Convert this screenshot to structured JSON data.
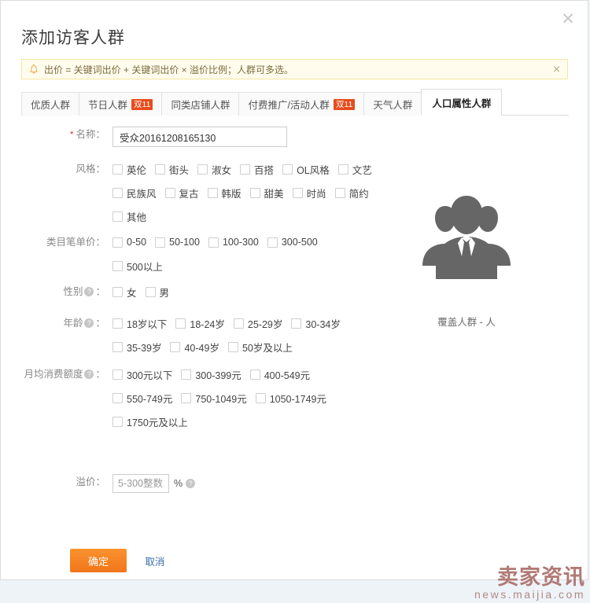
{
  "dialog": {
    "title": "添加访客人群",
    "close_icon": "close-icon"
  },
  "notice": {
    "icon": "bell-icon",
    "text": "出价 = 关键词出价 + 关键词出价 × 溢价比例；人群可多选。",
    "close_label": "×"
  },
  "tabs": [
    {
      "label": "优质人群",
      "badge": "",
      "active": false
    },
    {
      "label": "节日人群",
      "badge": "双11",
      "active": false
    },
    {
      "label": "同类店铺人群",
      "badge": "",
      "active": false
    },
    {
      "label": "付费推广/活动人群",
      "badge": "双11",
      "active": false
    },
    {
      "label": "天气人群",
      "badge": "",
      "active": false
    },
    {
      "label": "人口属性人群",
      "badge": "",
      "active": true
    }
  ],
  "form": {
    "name": {
      "label": "名称：",
      "required_mark": "*",
      "value": "受众20161208165130"
    },
    "style": {
      "label": "风格：",
      "options": [
        "英伦",
        "街头",
        "淑女",
        "百搭",
        "OL风格",
        "文艺",
        "民族风",
        "复古",
        "韩版",
        "甜美",
        "时尚",
        "简约",
        "其他"
      ]
    },
    "unit_price": {
      "label": "类目笔单价：",
      "options": [
        "0-50",
        "50-100",
        "100-300",
        "300-500",
        "500以上"
      ]
    },
    "gender": {
      "label": "性别",
      "help_icon": "question-icon",
      "colon": "：",
      "options": [
        "女",
        "男"
      ]
    },
    "age": {
      "label": "年龄",
      "help_icon": "question-icon",
      "colon": "：",
      "options": [
        "18岁以下",
        "18-24岁",
        "25-29岁",
        "30-34岁",
        "35-39岁",
        "40-49岁",
        "50岁及以上"
      ]
    },
    "spend": {
      "label": "月均消费额度",
      "help_icon": "question-icon",
      "colon": "：",
      "options": [
        "300元以下",
        "300-399元",
        "400-549元",
        "550-749元",
        "750-1049元",
        "1050-1749元",
        "1750元及以上"
      ]
    },
    "premium": {
      "label": "溢价：",
      "placeholder": "5-300整数",
      "value": "",
      "suffix": "%",
      "help_icon": "question-icon"
    }
  },
  "illustration": {
    "icon": "people-group-icon",
    "caption": "覆盖人群 - 人",
    "color": "#666666"
  },
  "footer": {
    "confirm_label": "确定",
    "cancel_label": "取消"
  },
  "watermark": {
    "main": "卖家资讯",
    "sub": "news.maijia.com",
    "color": "#b07a75"
  }
}
